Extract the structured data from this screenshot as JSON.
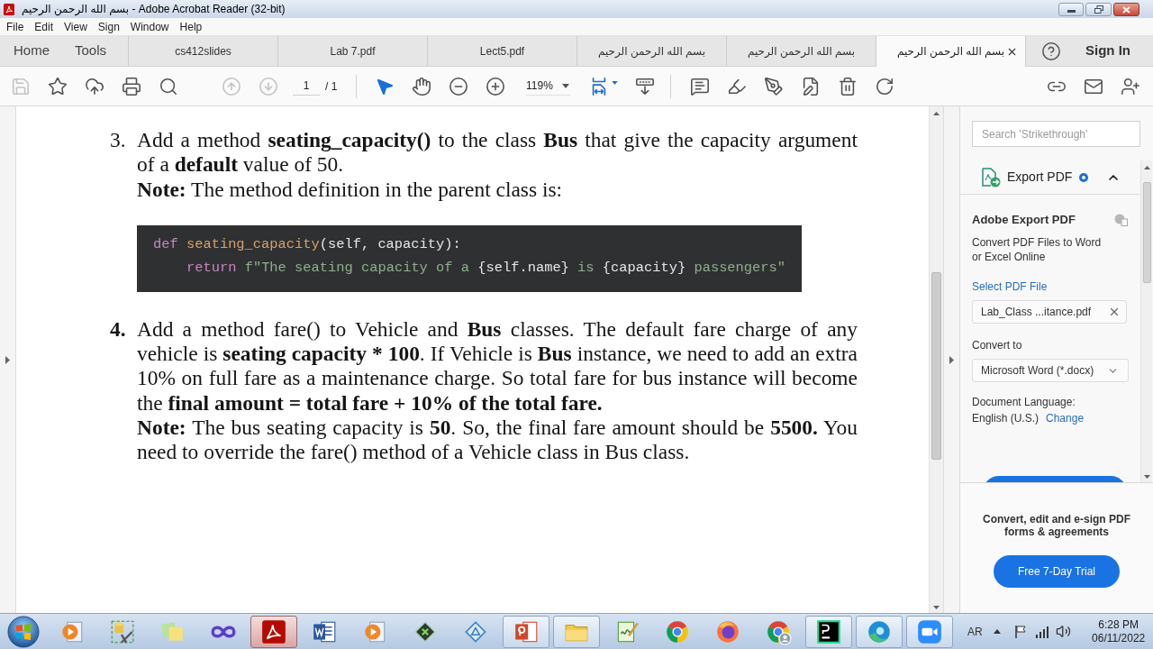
{
  "window": {
    "title": "بسم الله الرحمن الرحيم - Adobe Acrobat Reader (32-bit)"
  },
  "menu": [
    "File",
    "Edit",
    "View",
    "Sign",
    "Window",
    "Help"
  ],
  "nav": [
    "Home",
    "Tools"
  ],
  "tabs": [
    {
      "label": "cs412slides",
      "selected": false
    },
    {
      "label": "Lab 7.pdf",
      "selected": false
    },
    {
      "label": "Lect5.pdf",
      "selected": false
    },
    {
      "label": "بسم الله الرحمن الرحيم",
      "selected": false
    },
    {
      "label": "بسم الله الرحمن الرحيم",
      "selected": false
    },
    {
      "label": "بسم الله الرحمن الرحيم",
      "selected": true
    }
  ],
  "sign_in": "Sign In",
  "toolbar": {
    "file_tools": [
      {
        "kind": "save",
        "disabled": true
      },
      {
        "kind": "star",
        "disabled": false
      },
      {
        "kind": "upload",
        "disabled": false
      },
      {
        "kind": "print",
        "disabled": false
      },
      {
        "kind": "find",
        "disabled": false
      }
    ],
    "page_nav": [
      {
        "kind": "previous",
        "disabled": true
      },
      {
        "kind": "next",
        "disabled": true
      }
    ],
    "page": {
      "current": "1",
      "total": "/ 1"
    },
    "view_tools": [
      {
        "kind": "select",
        "selected": true
      },
      {
        "kind": "hand",
        "selected": false
      },
      {
        "kind": "zoom_out",
        "selected": false
      },
      {
        "kind": "zoom_in",
        "selected": false
      }
    ],
    "zoom": "119%",
    "layout_tools": [
      {
        "kind": "fit_page",
        "selected": true
      },
      {
        "kind": "scroll",
        "selected": false
      }
    ],
    "edit_tools": [
      {
        "kind": "comment"
      },
      {
        "kind": "highlight"
      },
      {
        "kind": "sign"
      },
      {
        "kind": "edit"
      },
      {
        "kind": "delete"
      },
      {
        "kind": "rotate"
      }
    ],
    "share_tools": [
      {
        "kind": "link"
      },
      {
        "kind": "mail"
      },
      {
        "kind": "add_user"
      }
    ]
  },
  "document": {
    "items": [
      {
        "number": "3.",
        "number_bold": false,
        "paragraphs": [
          {
            "lines": [
              "Add a method **seating_capacity()** to the class **Bus** that give the capacity argument",
              "of a **default** value of 50."
            ]
          },
          {
            "lines": [
              "**Note:** The method definition in the parent class is:"
            ]
          }
        ],
        "code": [
          {
            "indented": false,
            "tokens": [
              {
                "kind": "keyword",
                "text": "def"
              },
              {
                "kind": "function",
                "text": " seating_capacity"
              },
              {
                "kind": "plain",
                "text": "(self, capacity):"
              }
            ]
          },
          {
            "indented": true,
            "tokens": [
              {
                "kind": "keyword",
                "text": "return"
              },
              {
                "kind": "string",
                "text": " f\"The seating capacity of a "
              },
              {
                "kind": "plain",
                "text": "{self.name}"
              },
              {
                "kind": "string",
                "text": " is "
              },
              {
                "kind": "plain",
                "text": "{capacity}"
              },
              {
                "kind": "string",
                "text": " passengers\""
              }
            ]
          }
        ]
      },
      {
        "number": "4.",
        "number_bold": true,
        "paragraphs": [
          {
            "lines": [
              "Add a method fare() to Vehicle and **Bus** classes. The default fare charge of any",
              "vehicle is **seating capacity * 100**. If Vehicle is **Bus** instance, we need to add an extra",
              "10% on full fare as a maintenance charge. So total fare for bus instance will become",
              "the **final amount = total fare + 10% of the total fare.**"
            ]
          },
          {
            "lines": [
              "**Note:** The bus seating capacity is **50**. So, the final fare amount should be **5500.** You",
              "need to override the fare() method of a Vehicle class in Bus class."
            ]
          }
        ]
      }
    ]
  },
  "side_panel": {
    "search": {
      "placeholder": "Search 'Strikethrough'"
    },
    "export": {
      "title": "Export PDF",
      "expanded": true,
      "heading": "Adobe Export PDF",
      "description": "Convert PDF Files to Word or Excel Online",
      "select_label": "Select PDF File",
      "file": "Lab_Class ...itance.pdf",
      "convert_label": "Convert to",
      "format": "Microsoft Word (*.docx)",
      "language_label": "Document Language:",
      "language": "English (U.S.)",
      "change": "Change"
    },
    "promo": {
      "text": "Convert, edit and e-sign PDF forms & agreements",
      "button": "Free 7-Day Trial"
    }
  },
  "taskbar": {
    "apps": [
      {
        "kind": "media",
        "open": false,
        "selected": false
      },
      {
        "kind": "tools",
        "open": false,
        "selected": false
      },
      {
        "kind": "notes",
        "open": false,
        "selected": false
      },
      {
        "kind": "infinity",
        "open": false,
        "selected": false
      },
      {
        "kind": "pdf",
        "open": true,
        "selected": true
      },
      {
        "kind": "word",
        "open": false,
        "selected": false
      },
      {
        "kind": "media",
        "open": false,
        "selected": false
      },
      {
        "kind": "green_app",
        "open": false,
        "selected": false
      },
      {
        "kind": "blue_app",
        "open": false,
        "selected": false
      },
      {
        "kind": "slides",
        "open": true,
        "selected": false
      },
      {
        "kind": "folder",
        "open": true,
        "selected": false
      },
      {
        "kind": "notepad",
        "open": false,
        "selected": false
      },
      {
        "kind": "chrome",
        "open": false,
        "selected": false
      },
      {
        "kind": "firefox",
        "open": false,
        "selected": false
      },
      {
        "kind": "chrome_profile",
        "open": false,
        "selected": false
      },
      {
        "kind": "pycharm",
        "open": true,
        "selected": false
      },
      {
        "kind": "edge",
        "open": true,
        "selected": false
      },
      {
        "kind": "zoom",
        "open": true,
        "selected": false
      }
    ],
    "tray": {
      "language": "AR",
      "time": "6:28 PM",
      "date": "06/11/2022"
    }
  }
}
